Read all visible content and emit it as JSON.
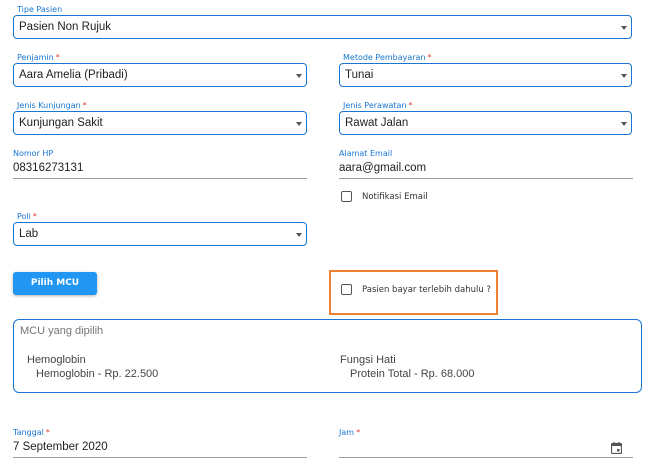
{
  "tipe_pasien": {
    "label": "Tipe Pasien",
    "value": "Pasien Non Rujuk"
  },
  "penjamin": {
    "label": "Penjamin",
    "required": "*",
    "value": "Aara Amelia (Pribadi)"
  },
  "metode_pembayaran": {
    "label": "Metode Pembayaran",
    "required": "*",
    "value": "Tunai"
  },
  "jenis_kunjungan": {
    "label": "Jenis Kunjungan",
    "required": "*",
    "value": "Kunjungan Sakit"
  },
  "jenis_perawatan": {
    "label": "Jenis Perawatan",
    "required": "*",
    "value": "Rawat Jalan"
  },
  "nomor_hp": {
    "label": "Nomor HP",
    "value": "08316273131"
  },
  "alamat_email": {
    "label": "Alamat Email",
    "value": "aara@gmail.com"
  },
  "notifikasi_email": {
    "label": "Notifikasi Email",
    "checked": false
  },
  "poli": {
    "label": "Poli",
    "required": "*",
    "value": "Lab"
  },
  "pilih_mcu_button": "Pilih MCU",
  "pasien_bayar": {
    "label": "Pasien bayar terlebih dahulu ?",
    "checked": false
  },
  "mcu": {
    "title": "MCU yang dipilih",
    "items": [
      {
        "name": "Hemoglobin",
        "detail": "Hemoglobin - Rp. 22.500"
      },
      {
        "name": "Fungsi Hati",
        "detail": "Protein Total - Rp. 68.000"
      }
    ]
  },
  "tanggal": {
    "label": "Tanggal",
    "required": "*",
    "value": "7 September 2020"
  },
  "jam": {
    "label": "Jam",
    "required": "*",
    "value": "",
    "icon": "calendar-icon"
  },
  "colors": {
    "accent": "#1976d2",
    "button": "#2196f3",
    "highlight": "#ee8232",
    "required": "#e53935"
  }
}
